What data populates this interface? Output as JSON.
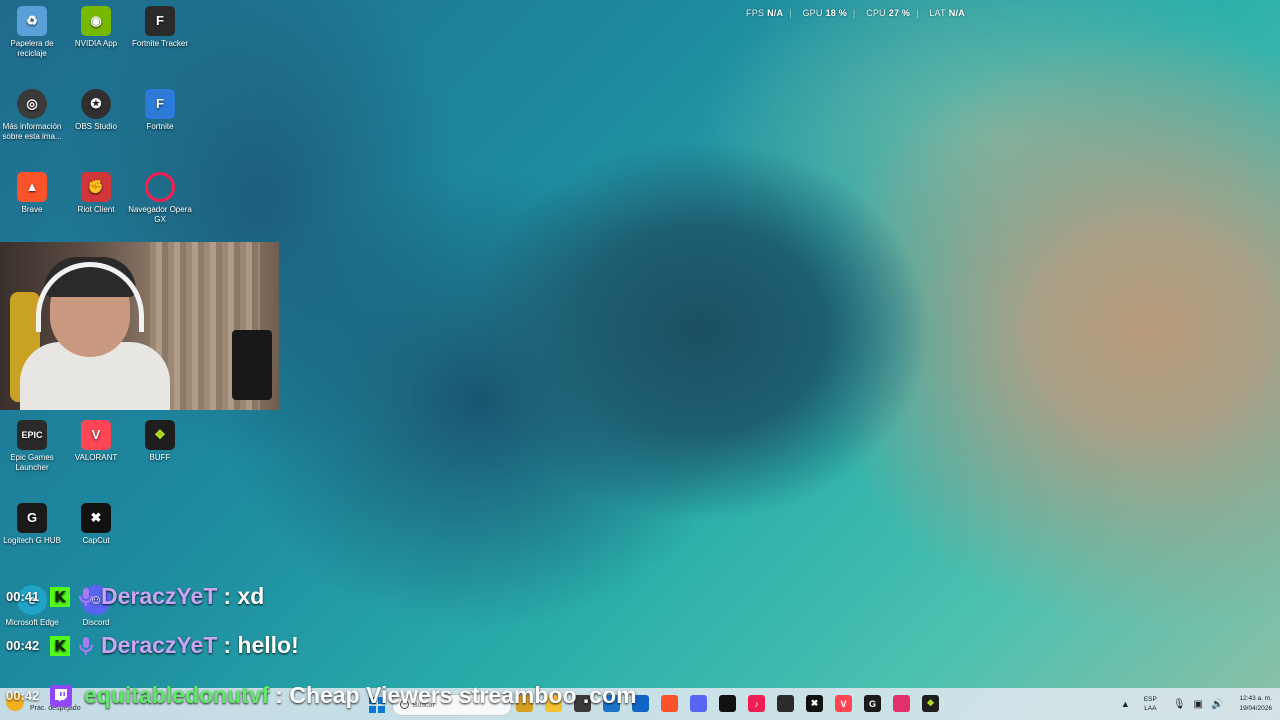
{
  "overlay_stats": {
    "fps_label": "FPS",
    "fps_value": "N/A",
    "gpu_label": "GPU",
    "gpu_value": "18 %",
    "cpu_label": "CPU",
    "cpu_value": "27 %",
    "lat_label": "LAT",
    "lat_value": "N/A"
  },
  "desktop_icons": [
    {
      "label": "Papelera de reciclaje",
      "icon": "recycle-bin-icon",
      "color": "#5aa0d8"
    },
    {
      "label": "NVIDIA App",
      "icon": "nvidia-icon",
      "color": "#76b900"
    },
    {
      "label": "Fortnite Tracker",
      "icon": "fortnite-tracker-icon",
      "color": "#2b2b2b"
    },
    {
      "label": "Más información sobre esta ima...",
      "icon": "info-icon",
      "color": "#3a3a3a"
    },
    {
      "label": "OBS Studio",
      "icon": "obs-icon",
      "color": "#302e31"
    },
    {
      "label": "Fortnite",
      "icon": "fortnite-icon",
      "color": "#2d7bd8"
    },
    {
      "label": "Brave",
      "icon": "brave-icon",
      "color": "#fb542b"
    },
    {
      "label": "Riot Client",
      "icon": "riot-client-icon",
      "color": "#d13639"
    },
    {
      "label": "Navegador Opera GX",
      "icon": "opera-gx-icon",
      "color": "#fa1e4e"
    },
    {
      "label": "Epic Games Launcher",
      "icon": "epic-games-icon",
      "color": "#2a2a2a"
    },
    {
      "label": "VALORANT",
      "icon": "valorant-icon",
      "color": "#ff4655"
    },
    {
      "label": "BUFF",
      "icon": "buff-icon",
      "color": "#1e1e1e"
    },
    {
      "label": "Logitech G HUB",
      "icon": "logitech-icon",
      "color": "#1a1a1a"
    },
    {
      "label": "CapCut",
      "icon": "capcut-icon",
      "color": "#111111"
    },
    {
      "label": "Microsoft Edge",
      "icon": "edge-icon",
      "color": "#1fa3c7"
    },
    {
      "label": "Discord",
      "icon": "discord-icon",
      "color": "#5865f2"
    }
  ],
  "chat": [
    {
      "time": "00:41",
      "user": "DeraczYeT",
      "message": ": xd"
    },
    {
      "time": "00:42",
      "user": "DeraczYeT",
      "message": ": hello!"
    }
  ],
  "twitch_chat": {
    "time": "00:42",
    "user": "equitabledonutvf",
    "message": ": Cheap Viewers streamboo .com"
  },
  "taskbar": {
    "weather": "Prac. despejado",
    "search_placeholder": "Buscar",
    "language_line1": "ESP",
    "language_line2": "LAA",
    "time": "12:43 a. m.",
    "date": "19/04/2026",
    "pinned": [
      {
        "icon": "ftp-app-icon",
        "color": "#d8a020"
      },
      {
        "icon": "file-explorer-icon",
        "color": "#f2c033"
      },
      {
        "icon": "task-view-icon",
        "color": "#3a3a3a"
      },
      {
        "icon": "store-icon",
        "color": "#1a73c8"
      },
      {
        "icon": "mail-icon",
        "color": "#1064c4"
      },
      {
        "icon": "brave-taskbar-icon",
        "color": "#fb542b"
      },
      {
        "icon": "discord-taskbar-icon",
        "color": "#5865f2"
      },
      {
        "icon": "tiktok-studio-icon",
        "color": "#111111"
      },
      {
        "icon": "tiktok-icon",
        "color": "#ee1d52"
      },
      {
        "icon": "obs-taskbar-icon",
        "color": "#2b2b2b"
      },
      {
        "icon": "capcut-taskbar-icon",
        "color": "#111111"
      },
      {
        "icon": "valorant-taskbar-icon",
        "color": "#ff4655"
      },
      {
        "icon": "logitech-taskbar-icon",
        "color": "#1a1a1a"
      },
      {
        "icon": "kick-taskbar-icon",
        "color": "#e1306c"
      },
      {
        "icon": "buff-taskbar-icon",
        "color": "#1e1e1e"
      }
    ]
  }
}
